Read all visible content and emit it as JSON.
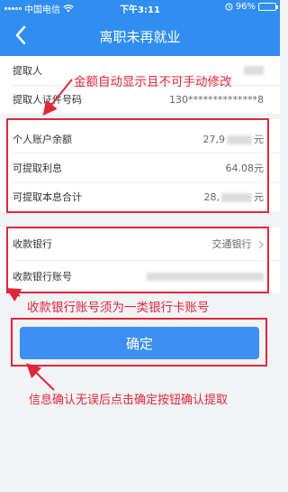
{
  "status_bar": {
    "carrier": "中国电信",
    "time": "下午3:11",
    "battery": "96%",
    "battery_level": 0.96
  },
  "nav": {
    "title": "离职未再就业",
    "back_icon": "chevron-left-icon"
  },
  "info": {
    "extractor_label": "提取人",
    "extractor_id_label": "提取人证件号码",
    "extractor_id_value": "130**************8"
  },
  "balance": {
    "account_balance_label": "个人账户余额",
    "account_balance_value_visible": "27,9",
    "account_balance_unit": "元",
    "interest_label": "可提取利息",
    "interest_value": "64.08元",
    "total_label": "可提取本息合计",
    "total_value_visible": "28,",
    "total_unit": "元"
  },
  "bank": {
    "bank_label": "收款银行",
    "bank_value": "交通银行",
    "account_label": "收款银行账号"
  },
  "confirm_button": "确定",
  "annotations": {
    "amount_note": "金额自动显示且不可手动修改",
    "account_note": "收款银行账号须为一类银行卡账号",
    "confirm_note": "信息确认无误后点击确定按钮确认提取"
  },
  "colors": {
    "header_blue": "#2f8ef0",
    "button_blue": "#3d8ff1",
    "annotation_red": "#e0273b"
  }
}
